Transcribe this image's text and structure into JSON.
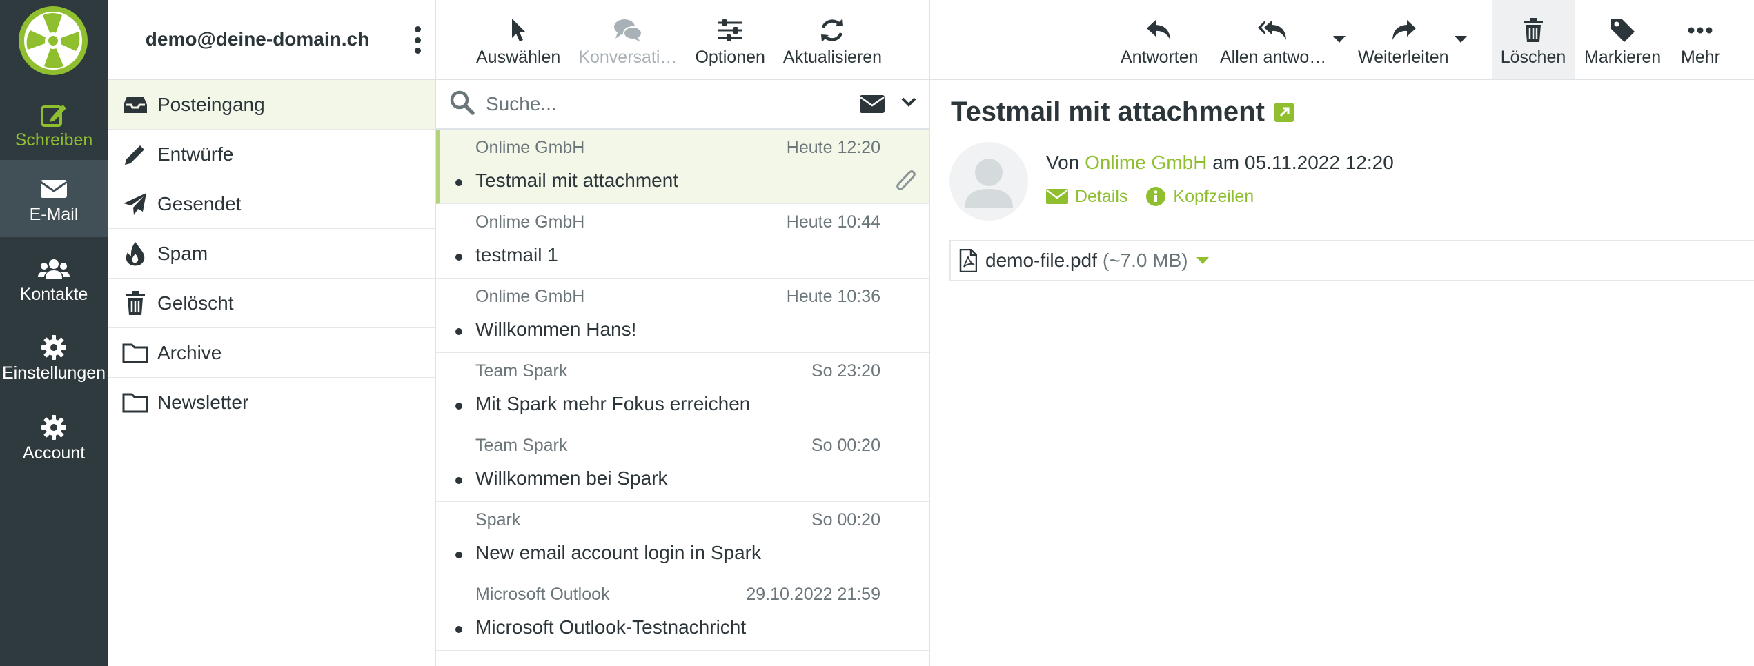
{
  "colors": {
    "accent": "#8fbf2f",
    "nav_bg": "#2f3a3f",
    "nav_active": "#414f56",
    "selected_row": "#f2f7e8"
  },
  "nav": {
    "logo_icon": "fan-logo",
    "items": [
      {
        "label": "Schreiben",
        "icon": "compose-icon"
      },
      {
        "label": "E-Mail",
        "icon": "envelope-icon"
      },
      {
        "label": "Kontakte",
        "icon": "users-icon"
      },
      {
        "label": "Einstellungen",
        "icon": "gear-icon"
      },
      {
        "label": "Account",
        "icon": "gear-icon"
      }
    ]
  },
  "folders": {
    "user": "demo@deine-domain.ch",
    "items": [
      {
        "label": "Posteingang",
        "icon": "inbox-icon"
      },
      {
        "label": "Entwürfe",
        "icon": "pencil-icon"
      },
      {
        "label": "Gesendet",
        "icon": "paper-plane-icon"
      },
      {
        "label": "Spam",
        "icon": "fire-icon"
      },
      {
        "label": "Gelöscht",
        "icon": "trash-icon"
      },
      {
        "label": "Archive",
        "icon": "folder-icon"
      },
      {
        "label": "Newsletter",
        "icon": "folder-icon"
      }
    ]
  },
  "list": {
    "toolbar": {
      "select": "Auswählen",
      "threads": "Konversati…",
      "options": "Optionen",
      "refresh": "Aktualisieren"
    },
    "search": {
      "placeholder": "Suche..."
    },
    "messages": [
      {
        "from": "Onlime GmbH",
        "date": "Heute 12:20",
        "subject": "Testmail mit attachment",
        "attachment": true
      },
      {
        "from": "Onlime GmbH",
        "date": "Heute 10:44",
        "subject": "testmail 1"
      },
      {
        "from": "Onlime GmbH",
        "date": "Heute 10:36",
        "subject": "Willkommen Hans!"
      },
      {
        "from": "Team Spark",
        "date": "So 23:20",
        "subject": "Mit Spark mehr Fokus erreichen"
      },
      {
        "from": "Team Spark",
        "date": "So 00:20",
        "subject": "Willkommen bei Spark"
      },
      {
        "from": "Spark",
        "date": "So 00:20",
        "subject": "New email account login in Spark"
      },
      {
        "from": "Microsoft Outlook",
        "date": "29.10.2022 21:59",
        "subject": "Microsoft Outlook-Testnachricht"
      }
    ]
  },
  "pane": {
    "toolbar": {
      "reply": "Antworten",
      "reply_all": "Allen antwo…",
      "forward": "Weiterleiten",
      "delete": "Löschen",
      "mark": "Markieren",
      "more": "Mehr"
    },
    "subject": "Testmail mit attachment",
    "from_prefix": "Von",
    "sender": "Onlime GmbH",
    "date_text": "am 05.11.2022 12:20",
    "details": "Details",
    "headers": "Kopfzeilen",
    "attachment": {
      "name": "demo-file.pdf",
      "size": "(~7.0 MB)"
    }
  }
}
